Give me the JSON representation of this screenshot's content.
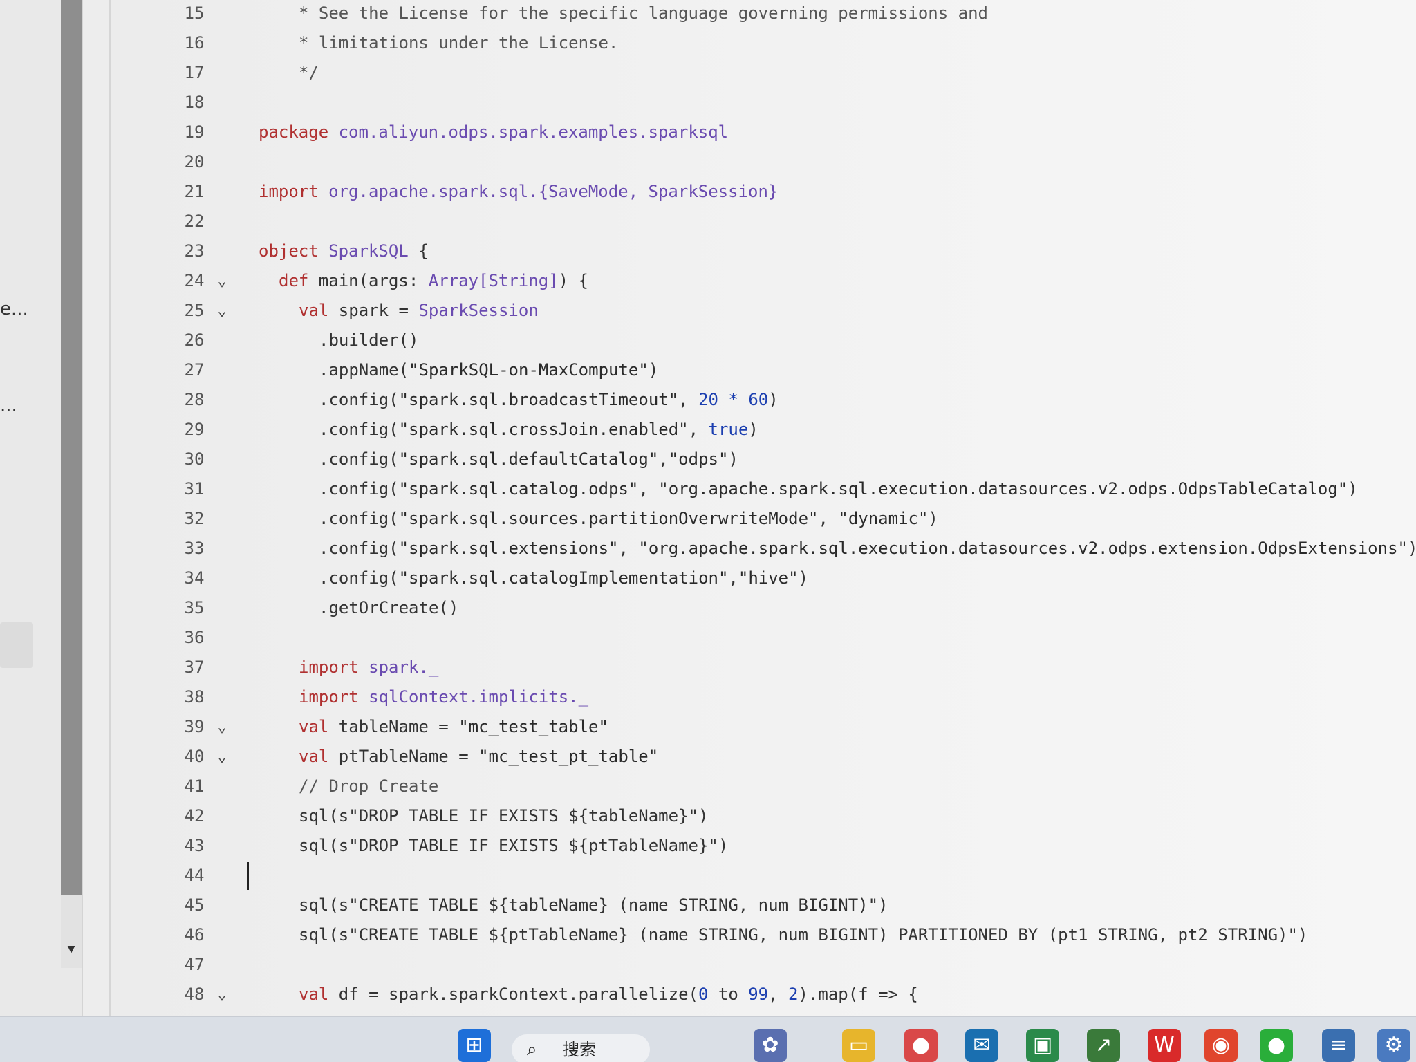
{
  "left_panel": {
    "trunc_items": [
      "e...",
      "..."
    ]
  },
  "editor": {
    "lines": [
      {
        "n": "15",
        "fold": "",
        "indent": 2,
        "tokens": [
          {
            "t": "* See the License for the specific language governing permissions and",
            "c": "cm"
          }
        ]
      },
      {
        "n": "16",
        "fold": "",
        "indent": 2,
        "tokens": [
          {
            "t": "* limitations under the License.",
            "c": "cm"
          }
        ]
      },
      {
        "n": "17",
        "fold": "",
        "indent": 2,
        "tokens": [
          {
            "t": "*/",
            "c": "cm"
          }
        ]
      },
      {
        "n": "18",
        "fold": "",
        "indent": 0,
        "tokens": []
      },
      {
        "n": "19",
        "fold": "",
        "indent": 0,
        "tokens": [
          {
            "t": "package ",
            "c": "kw"
          },
          {
            "t": "com.aliyun.odps.spark.examples.sparksql",
            "c": "ty"
          }
        ]
      },
      {
        "n": "20",
        "fold": "",
        "indent": 0,
        "tokens": []
      },
      {
        "n": "21",
        "fold": "",
        "indent": 0,
        "tokens": [
          {
            "t": "import ",
            "c": "kw"
          },
          {
            "t": "org.apache.spark.sql.{SaveMode, SparkSession}",
            "c": "ty"
          }
        ]
      },
      {
        "n": "22",
        "fold": "",
        "indent": 0,
        "tokens": []
      },
      {
        "n": "23",
        "fold": "",
        "indent": 0,
        "tokens": [
          {
            "t": "object ",
            "c": "kw"
          },
          {
            "t": "SparkSQL",
            "c": "ty"
          },
          {
            "t": " {",
            "c": ""
          }
        ]
      },
      {
        "n": "24",
        "fold": "⌄",
        "indent": 1,
        "tokens": [
          {
            "t": "def ",
            "c": "kw"
          },
          {
            "t": "main(args: ",
            "c": ""
          },
          {
            "t": "Array[String]",
            "c": "ty"
          },
          {
            "t": ") {",
            "c": ""
          }
        ]
      },
      {
        "n": "25",
        "fold": "⌄",
        "indent": 2,
        "tokens": [
          {
            "t": "val ",
            "c": "kw"
          },
          {
            "t": "spark = ",
            "c": ""
          },
          {
            "t": "SparkSession",
            "c": "ty"
          }
        ]
      },
      {
        "n": "26",
        "fold": "",
        "indent": 3,
        "tokens": [
          {
            "t": ".builder()",
            "c": ""
          }
        ]
      },
      {
        "n": "27",
        "fold": "",
        "indent": 3,
        "tokens": [
          {
            "t": ".appName(",
            "c": ""
          },
          {
            "t": "\"SparkSQL-on-MaxCompute\"",
            "c": "str"
          },
          {
            "t": ")",
            "c": ""
          }
        ]
      },
      {
        "n": "28",
        "fold": "",
        "indent": 3,
        "tokens": [
          {
            "t": ".config(",
            "c": ""
          },
          {
            "t": "\"spark.sql.broadcastTimeout\"",
            "c": "str"
          },
          {
            "t": ", ",
            "c": ""
          },
          {
            "t": "20 * 60",
            "c": "num"
          },
          {
            "t": ")",
            "c": ""
          }
        ]
      },
      {
        "n": "29",
        "fold": "",
        "indent": 3,
        "tokens": [
          {
            "t": ".config(",
            "c": ""
          },
          {
            "t": "\"spark.sql.crossJoin.enabled\"",
            "c": "str"
          },
          {
            "t": ", ",
            "c": ""
          },
          {
            "t": "true",
            "c": "num"
          },
          {
            "t": ")",
            "c": ""
          }
        ]
      },
      {
        "n": "30",
        "fold": "",
        "indent": 3,
        "tokens": [
          {
            "t": ".config(",
            "c": ""
          },
          {
            "t": "\"spark.sql.defaultCatalog\"",
            "c": "str"
          },
          {
            "t": ",",
            "c": ""
          },
          {
            "t": "\"odps\"",
            "c": "str"
          },
          {
            "t": ")",
            "c": ""
          }
        ]
      },
      {
        "n": "31",
        "fold": "",
        "indent": 3,
        "tokens": [
          {
            "t": ".config(",
            "c": ""
          },
          {
            "t": "\"spark.sql.catalog.odps\"",
            "c": "str"
          },
          {
            "t": ", ",
            "c": ""
          },
          {
            "t": "\"org.apache.spark.sql.execution.datasources.v2.odps.OdpsTableCatalog\"",
            "c": "str"
          },
          {
            "t": ")",
            "c": ""
          }
        ]
      },
      {
        "n": "32",
        "fold": "",
        "indent": 3,
        "tokens": [
          {
            "t": ".config(",
            "c": ""
          },
          {
            "t": "\"spark.sql.sources.partitionOverwriteMode\"",
            "c": "str"
          },
          {
            "t": ", ",
            "c": ""
          },
          {
            "t": "\"dynamic\"",
            "c": "str"
          },
          {
            "t": ")",
            "c": ""
          }
        ]
      },
      {
        "n": "33",
        "fold": "",
        "indent": 3,
        "tokens": [
          {
            "t": ".config(",
            "c": ""
          },
          {
            "t": "\"spark.sql.extensions\"",
            "c": "str"
          },
          {
            "t": ", ",
            "c": ""
          },
          {
            "t": "\"org.apache.spark.sql.execution.datasources.v2.odps.extension.OdpsExtensions\"",
            "c": "str"
          },
          {
            "t": ")",
            "c": ""
          }
        ]
      },
      {
        "n": "34",
        "fold": "",
        "indent": 3,
        "tokens": [
          {
            "t": ".config(",
            "c": ""
          },
          {
            "t": "\"spark.sql.catalogImplementation\"",
            "c": "str"
          },
          {
            "t": ",",
            "c": ""
          },
          {
            "t": "\"hive\"",
            "c": "str"
          },
          {
            "t": ")",
            "c": ""
          }
        ]
      },
      {
        "n": "35",
        "fold": "",
        "indent": 3,
        "tokens": [
          {
            "t": ".getOrCreate()",
            "c": ""
          }
        ]
      },
      {
        "n": "36",
        "fold": "",
        "indent": 0,
        "tokens": []
      },
      {
        "n": "37",
        "fold": "",
        "indent": 2,
        "tokens": [
          {
            "t": "import ",
            "c": "kw"
          },
          {
            "t": "spark._",
            "c": "ty"
          }
        ]
      },
      {
        "n": "38",
        "fold": "",
        "indent": 2,
        "tokens": [
          {
            "t": "import ",
            "c": "kw"
          },
          {
            "t": "sqlContext.implicits._",
            "c": "ty"
          }
        ]
      },
      {
        "n": "39",
        "fold": "⌄",
        "indent": 2,
        "tokens": [
          {
            "t": "val ",
            "c": "kw"
          },
          {
            "t": "tableName = ",
            "c": ""
          },
          {
            "t": "\"mc_test_table\"",
            "c": "str"
          }
        ]
      },
      {
        "n": "40",
        "fold": "⌄",
        "indent": 2,
        "tokens": [
          {
            "t": "val ",
            "c": "kw"
          },
          {
            "t": "ptTableName = ",
            "c": ""
          },
          {
            "t": "\"mc_test_pt_table\"",
            "c": "str"
          }
        ]
      },
      {
        "n": "41",
        "fold": "",
        "indent": 2,
        "tokens": [
          {
            "t": "// Drop Create",
            "c": "cm"
          }
        ]
      },
      {
        "n": "42",
        "fold": "",
        "indent": 2,
        "tokens": [
          {
            "t": "sql(s\"DROP TABLE IF EXISTS ${tableName}\")",
            "c": ""
          }
        ]
      },
      {
        "n": "43",
        "fold": "",
        "indent": 2,
        "tokens": [
          {
            "t": "sql(s\"DROP TABLE IF EXISTS ${ptTableName}\")",
            "c": ""
          }
        ]
      },
      {
        "n": "44",
        "fold": "",
        "indent": 0,
        "tokens": []
      },
      {
        "n": "45",
        "fold": "",
        "indent": 2,
        "tokens": [
          {
            "t": "sql(s\"CREATE TABLE ${tableName} (name STRING, num BIGINT)\")",
            "c": ""
          }
        ]
      },
      {
        "n": "46",
        "fold": "",
        "indent": 2,
        "tokens": [
          {
            "t": "sql(s\"CREATE TABLE ${ptTableName} (name STRING, num BIGINT) PARTITIONED BY (pt1 STRING, pt2 STRING)\")",
            "c": ""
          }
        ]
      },
      {
        "n": "47",
        "fold": "",
        "indent": 0,
        "tokens": []
      },
      {
        "n": "48",
        "fold": "⌄",
        "indent": 2,
        "tokens": [
          {
            "t": "val ",
            "c": "kw"
          },
          {
            "t": "df = spark.sparkContext.parallelize(",
            "c": ""
          },
          {
            "t": "0",
            "c": "num"
          },
          {
            "t": " to ",
            "c": ""
          },
          {
            "t": "99",
            "c": "num"
          },
          {
            "t": ", ",
            "c": ""
          },
          {
            "t": "2",
            "c": "num"
          },
          {
            "t": ").map(f => {",
            "c": ""
          }
        ]
      }
    ]
  },
  "taskbar": {
    "search_icon": "search-icon",
    "search_label": "搜索",
    "apps": [
      {
        "name": "windows-start-icon",
        "glyph": "⊞",
        "color": "#1e6fd9"
      },
      {
        "name": "widget-icon",
        "glyph": "✿",
        "color": "#5a6fb0"
      },
      {
        "name": "file-explorer-icon",
        "glyph": "▭",
        "color": "#e7b52c"
      },
      {
        "name": "pin-app-icon",
        "glyph": "●",
        "color": "#d94848"
      },
      {
        "name": "mail-app-icon",
        "glyph": "✉",
        "color": "#1a6fb0"
      },
      {
        "name": "pycharm-icon",
        "glyph": "▣",
        "color": "#2a8a4a"
      },
      {
        "name": "chart-app-icon",
        "glyph": "↗",
        "color": "#3a7a3a"
      },
      {
        "name": "wps-icon",
        "glyph": "W",
        "color": "#d92a2a"
      },
      {
        "name": "chrome-icon",
        "glyph": "◉",
        "color": "#e0452d"
      },
      {
        "name": "wechat-icon",
        "glyph": "●",
        "color": "#2aae3a"
      },
      {
        "name": "notepad-icon",
        "glyph": "≡",
        "color": "#3a6fb0"
      },
      {
        "name": "settings-icon",
        "glyph": "⚙",
        "color": "#4a7ac0"
      }
    ]
  }
}
